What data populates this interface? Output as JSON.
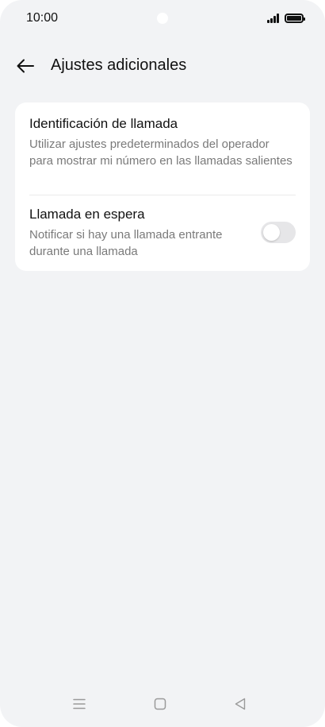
{
  "status_bar": {
    "time": "10:00",
    "signal_icon": "signal-bars-icon",
    "battery_icon": "battery-full-icon"
  },
  "header": {
    "back_icon": "arrow-left-icon",
    "title": "Ajustes adicionales"
  },
  "settings": [
    {
      "title": "Identificación de llamada",
      "description": "Utilizar ajustes predeterminados del operador para mostrar mi número en las llamadas salientes"
    },
    {
      "title": "Llamada en espera",
      "description": "Notificar si hay una llamada entrante durante una llamada",
      "toggle_on": false
    }
  ],
  "nav_bar": {
    "menu_icon": "menu-icon",
    "home_icon": "home-square-icon",
    "back_icon": "back-triangle-icon"
  },
  "colors": {
    "background": "#f2f3f5",
    "card": "#ffffff",
    "primary_text": "#111111",
    "secondary_text": "#7a7a7a",
    "toggle_off": "#e6e6e8"
  }
}
